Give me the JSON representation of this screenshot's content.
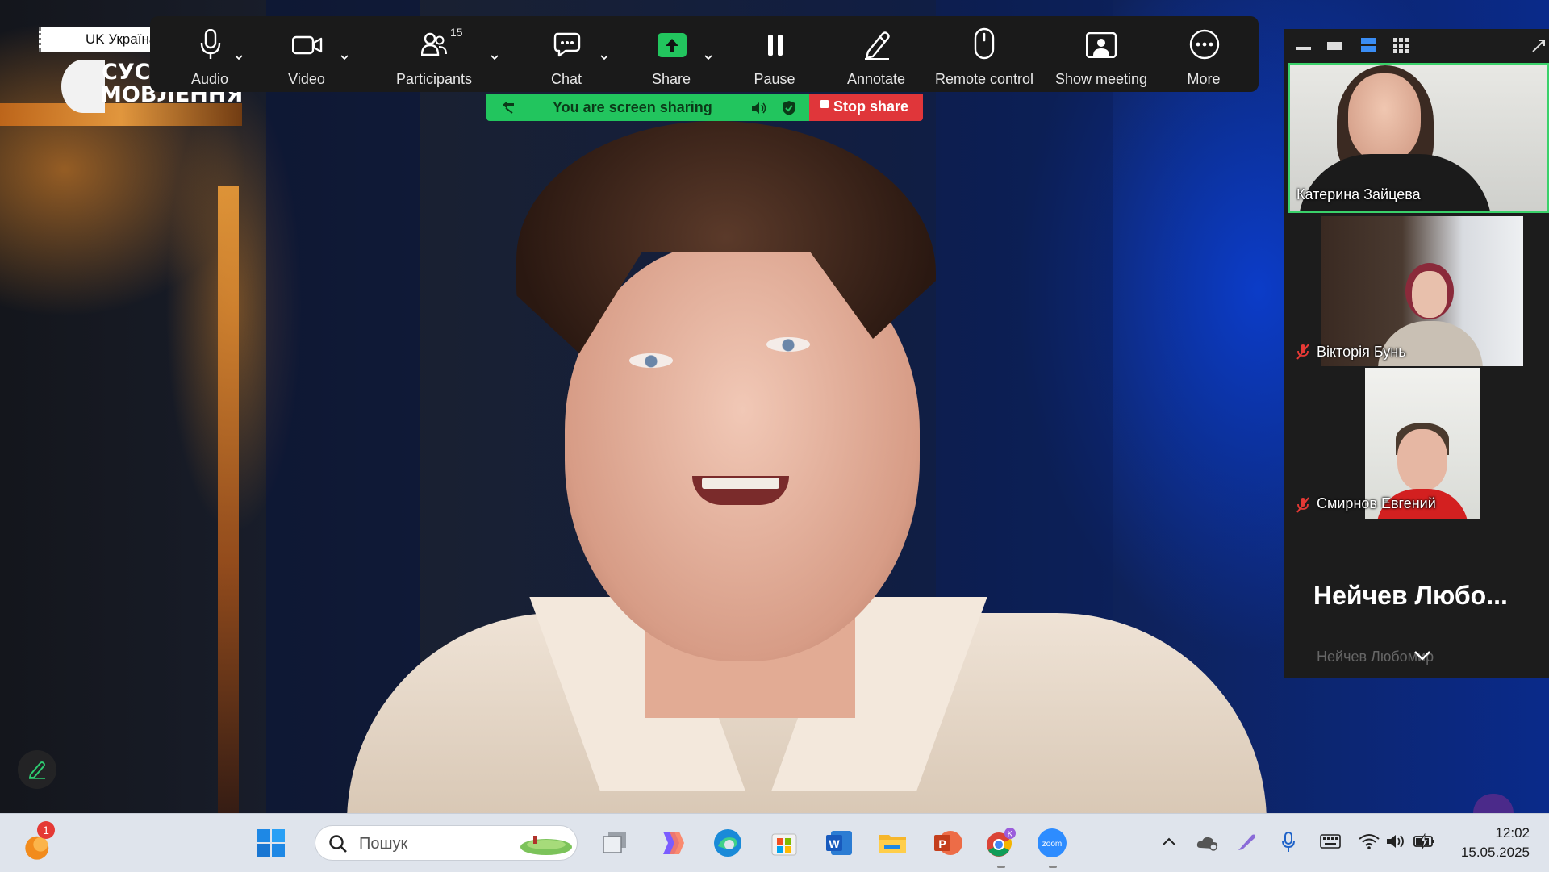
{
  "channel": {
    "live_label": "UK Україна",
    "logo_line1": "СУС",
    "logo_line2": "МОВЛЕННЯ"
  },
  "toolbar": {
    "audio_label": "Audio",
    "video_label": "Video",
    "participants_label": "Participants",
    "participants_count": "15",
    "chat_label": "Chat",
    "share_label": "Share",
    "pause_label": "Pause",
    "annotate_label": "Annotate",
    "remote_control_label": "Remote control",
    "show_meeting_label": "Show meeting",
    "more_label": "More"
  },
  "sharing": {
    "status_text": "You are screen sharing",
    "stop_label": "Stop share",
    "banner_color": "#22c55e",
    "stop_color": "#e0363a"
  },
  "participants": [
    {
      "name": "Катерина Зайцева",
      "muted": false,
      "active_speaker": true
    },
    {
      "name": "Вікторія Бунь",
      "muted": true
    },
    {
      "name": "Смирнов Евгений",
      "muted": true
    },
    {
      "name": "Нейчев Любо...",
      "muted": false
    }
  ],
  "participants_faded_name": "Нейчев Любомир",
  "taskbar": {
    "search_placeholder": "Пошук",
    "notification_count": "1",
    "time": "12:02",
    "date": "15.05.2025",
    "chrome_profile": "K",
    "zoom_label": "zoom"
  }
}
